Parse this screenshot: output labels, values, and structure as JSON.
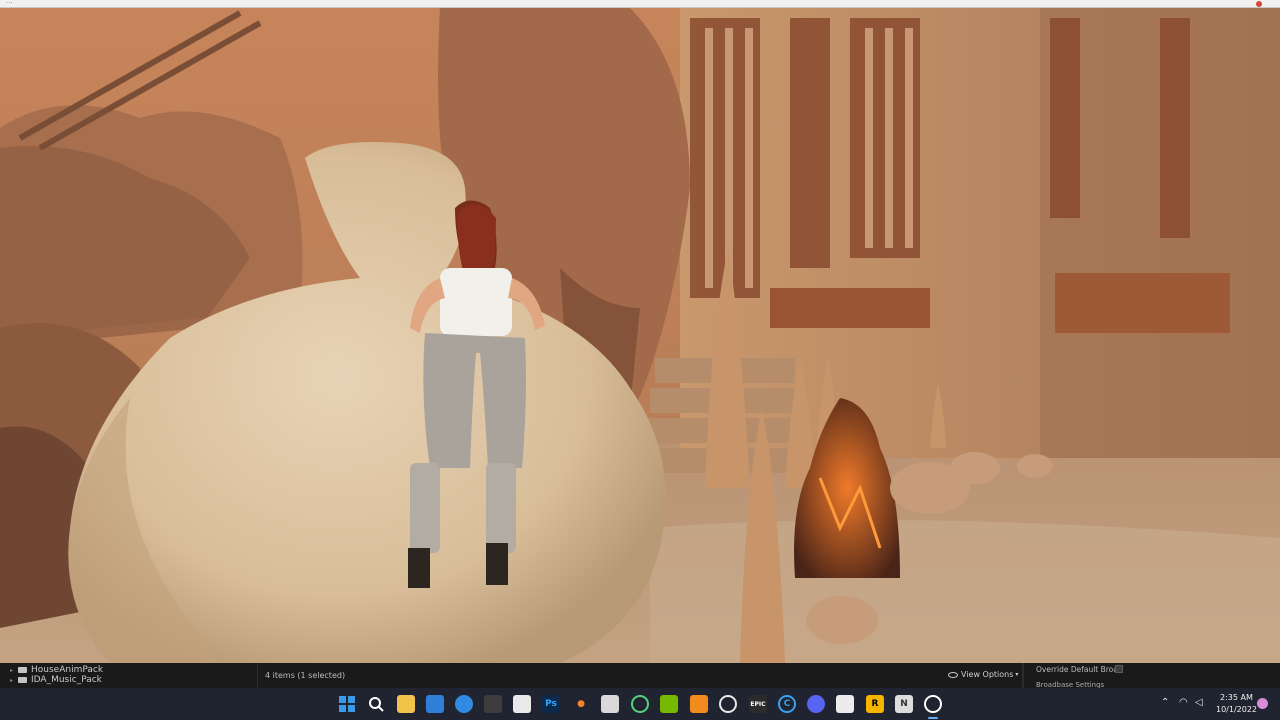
{
  "browser": {
    "url_fragment": "..."
  },
  "content_browser": {
    "folders": [
      {
        "label": "HouseAnimPack"
      },
      {
        "label": "IDA_Music_Pack"
      }
    ],
    "items_count": "4 items (1 selected)",
    "view_options_label": "View Options",
    "override_label": "Override Default Broa",
    "broadbase_label": "Broadbase Settings"
  },
  "taskbar": {
    "icons": [
      {
        "name": "windows-start-icon"
      },
      {
        "name": "search-icon"
      },
      {
        "name": "file-explorer-icon"
      },
      {
        "name": "store-icon"
      },
      {
        "name": "browser-icon"
      },
      {
        "name": "app-icon"
      },
      {
        "name": "capture-icon"
      },
      {
        "name": "photoshop-icon",
        "text": "Ps"
      },
      {
        "name": "blender-icon"
      },
      {
        "name": "unreal-tool-icon"
      },
      {
        "name": "app-green-icon"
      },
      {
        "name": "app-nvidia-icon"
      },
      {
        "name": "app-orange-icon"
      },
      {
        "name": "obs-icon"
      },
      {
        "name": "epic-games-icon"
      },
      {
        "name": "app-c-icon"
      },
      {
        "name": "discord-icon"
      },
      {
        "name": "app-monitor-icon"
      },
      {
        "name": "rockstar-icon"
      },
      {
        "name": "app-n-icon"
      },
      {
        "name": "unreal-engine-icon"
      }
    ],
    "clock_time": "2:35 AM",
    "clock_date": "10/1/2022"
  },
  "colors": {
    "taskbar": "#1f2430",
    "content_browser": "#1a1a1a",
    "accent": "#3a88e0"
  }
}
